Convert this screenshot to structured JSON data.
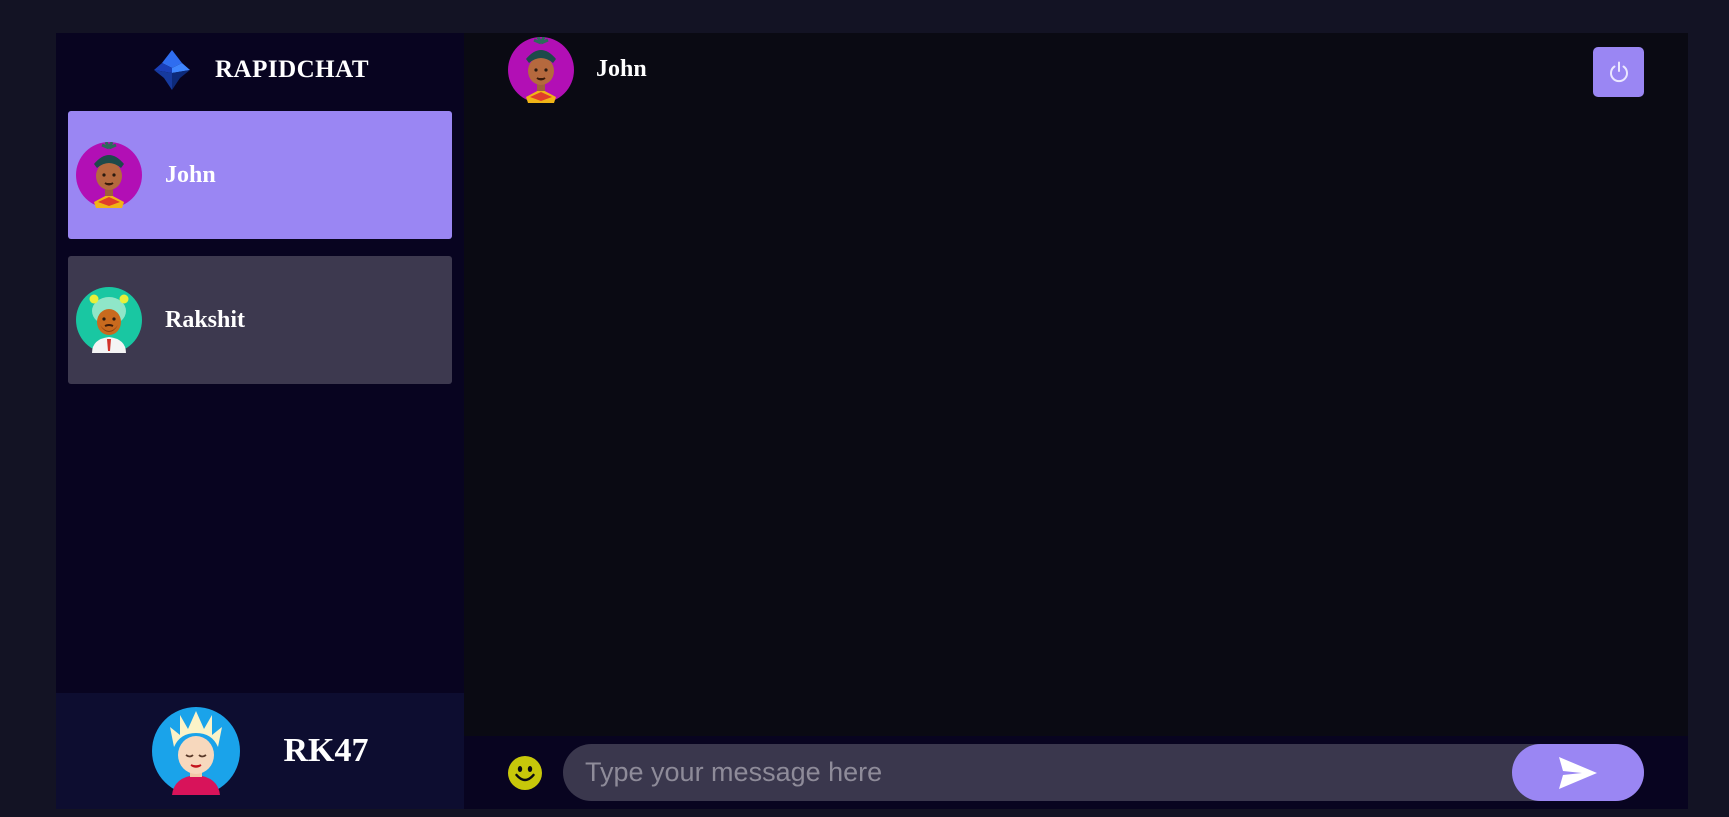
{
  "brand": {
    "name": "RAPIDCHAT",
    "logo_icon": "diamond-logo-icon"
  },
  "contacts": [
    {
      "name": "John",
      "selected": true,
      "avatar_icon": "avatar-magenta-dreadlocks-icon"
    },
    {
      "name": "Rakshit",
      "selected": false,
      "avatar_icon": "avatar-teal-bear-hat-icon"
    }
  ],
  "current_user": {
    "name": "RK47",
    "avatar_icon": "avatar-blue-blonde-spiky-icon"
  },
  "chat": {
    "header": {
      "contact_name": "John",
      "avatar_icon": "avatar-magenta-dreadlocks-icon"
    },
    "logout_icon": "power-icon",
    "input": {
      "placeholder": "Type your message here",
      "value": ""
    },
    "emoji_icon": "smiley-icon",
    "send_icon": "send-arrow-icon"
  },
  "colors": {
    "page_bg": "#131324",
    "sidebar_bg": "#080420",
    "chat_bg": "#0a0a13",
    "contact_bg": "#3d394f",
    "accent": "#9a86f3",
    "current_user_bg": "#0d0d30",
    "emoji": "#ffff00c8"
  }
}
